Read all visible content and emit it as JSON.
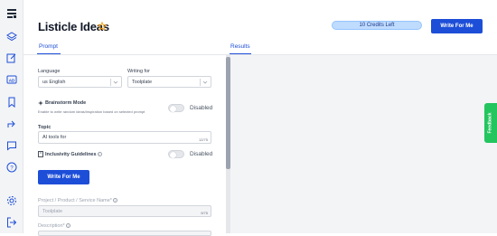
{
  "sidebar": {
    "icons": [
      "logo-icon",
      "layers-icon",
      "edit-icon",
      "ad-icon",
      "bookmark-icon",
      "share-icon",
      "chat-icon",
      "help-icon",
      "settings-icon",
      "logout-icon"
    ]
  },
  "header": {
    "title": "Listicle Ideas",
    "credits": "10 Credits Left",
    "write_button": "Write For Me"
  },
  "tabs": {
    "prompt": "Prompt",
    "results": "Results"
  },
  "form": {
    "language_label": "Language",
    "language_value": "us English",
    "writing_for_label": "Writing for",
    "writing_for_value": "Toolplate",
    "brainstorm_label": "Brainstorm Mode",
    "brainstorm_hint": "Enable to write random ideas/inspiration based on selected prompt",
    "brainstorm_state": "Disabled",
    "topic_label": "Topic",
    "topic_value": "AI tools for",
    "topic_counter": "12/75",
    "inclusivity_label": "Inclusivity Guidelines",
    "inclusivity_state": "Disabled",
    "write_button": "Write For Me",
    "project_label": "Project / Product / Service Name*",
    "project_value": "Toolplate",
    "project_counter": "9/75",
    "description_label": "Description*"
  },
  "feedback": "Feedback",
  "colors": {
    "accent": "#1d4ed8",
    "credits_bg": "#bfdbfe",
    "feedback": "#22c55e"
  }
}
